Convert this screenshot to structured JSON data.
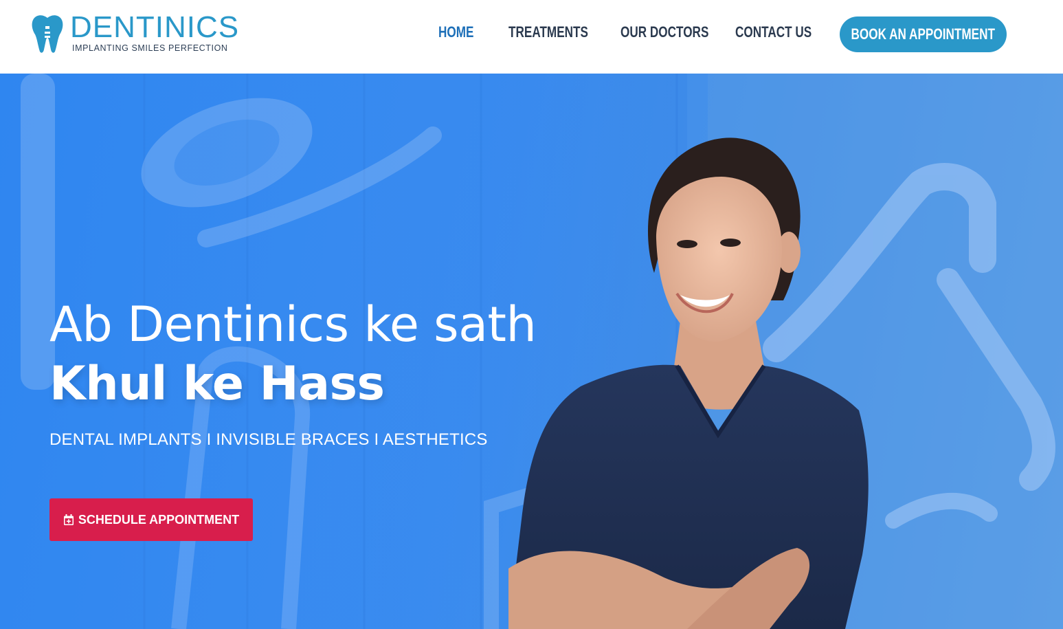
{
  "brand": {
    "name": "DENTINICS",
    "tagline": "IMPLANTING SMILES PERFECTION"
  },
  "nav": {
    "items": [
      {
        "label": "HOME",
        "active": true
      },
      {
        "label": "TREATMENTS",
        "active": false
      },
      {
        "label": "OUR DOCTORS",
        "active": false
      },
      {
        "label": "CONTACT US",
        "active": false
      }
    ],
    "cta_label": "BOOK AN APPOINTMENT"
  },
  "hero": {
    "title_line1": "Ab Dentinics ke sath",
    "title_line2": "Khul ke Hass",
    "subtitle": "DENTAL IMPLANTS I INVISIBLE BRACES I AESTHETICS",
    "button_label": "SCHEDULE APPOINTMENT",
    "button_icon": "calendar-plus-icon"
  },
  "colors": {
    "brand_blue": "#2a98c9",
    "nav_active": "#1d6fb8",
    "nav_text": "#2b3a4f",
    "hero_blue": "#3a8cf0",
    "cta_red": "#d81e4c",
    "scrubs_navy": "#1f2f52"
  }
}
